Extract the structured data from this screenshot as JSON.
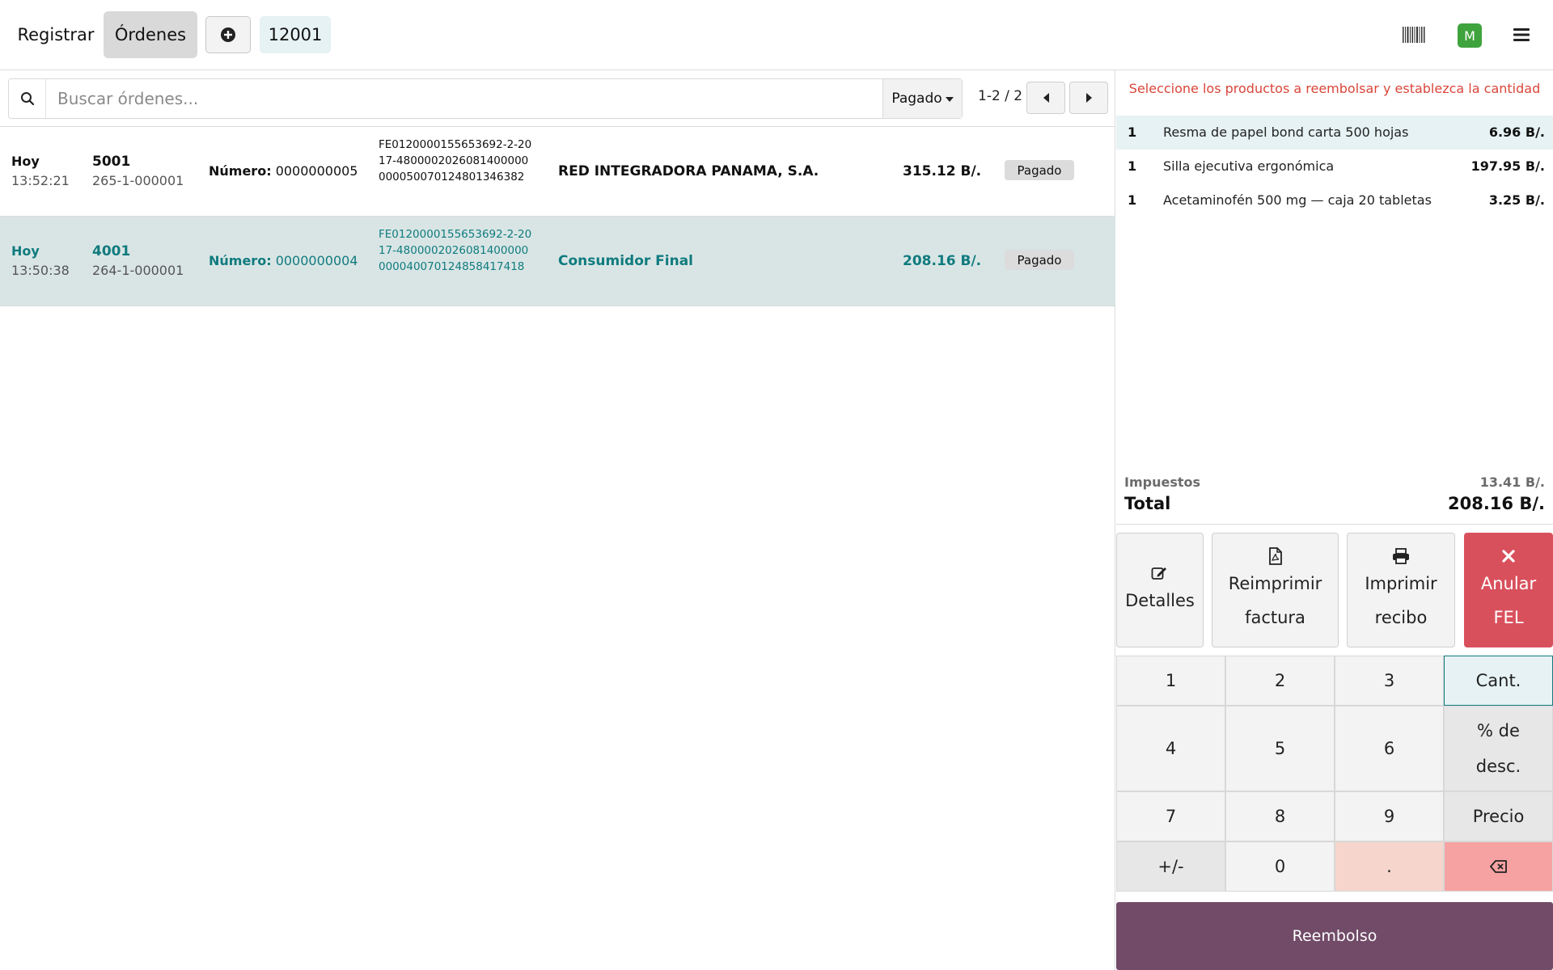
{
  "header": {
    "registrar_label": "Registrar",
    "ordenes_label": "Órdenes",
    "current_order": "12001",
    "avatar_initial": "M"
  },
  "search": {
    "placeholder": "Buscar órdenes...",
    "filter_label": "Pagado",
    "pager_text": "1-2 / 2"
  },
  "orders": [
    {
      "day": "Hoy",
      "time": "13:52:21",
      "number": "5001",
      "sequence": "265-1-000001",
      "numero_label": "Número:",
      "numero_value": "0000000005",
      "cufe": "FE0120000155653692-2-2017-4800002026081400000000050070124801346382",
      "client": "RED INTEGRADORA PANAMA, S.A.",
      "total": "315.12 B/.",
      "status": "Pagado"
    },
    {
      "day": "Hoy",
      "time": "13:50:38",
      "number": "4001",
      "sequence": "264-1-000001",
      "numero_label": "Número:",
      "numero_value": "0000000004",
      "cufe": "FE0120000155653692-2-2017-4800002026081400000000040070124858417418",
      "client": "Consumidor Final",
      "total": "208.16 B/.",
      "status": "Pagado"
    }
  ],
  "refund_panel": {
    "instruction": "Seleccione los productos a reembolsar y establezca la cantidad",
    "lines": [
      {
        "qty": "1",
        "name": "Resma de papel bond carta 500 hojas",
        "price": "6.96 B/."
      },
      {
        "qty": "1",
        "name": "Silla ejecutiva ergonómica",
        "price": "197.95 B/."
      },
      {
        "qty": "1",
        "name": "Acetaminofén 500 mg — caja 20 tabletas",
        "price": "3.25 B/."
      }
    ],
    "tax_label": "Impuestos",
    "tax_value": "13.41 B/.",
    "total_label": "Total",
    "total_value": "208.16 B/.",
    "actions": {
      "details": "Detalles",
      "reprint_line1": "Reimprimir",
      "reprint_line2": "factura",
      "print_line1": "Imprimir",
      "print_line2": "recibo",
      "cancel_line1": "Anular",
      "cancel_line2": "FEL"
    },
    "numpad": {
      "k1": "1",
      "k2": "2",
      "k3": "3",
      "qty": "Cant.",
      "k4": "4",
      "k5": "5",
      "k6": "6",
      "disc_line1": "% de",
      "disc_line2": "desc.",
      "k7": "7",
      "k8": "8",
      "k9": "9",
      "price": "Precio",
      "sign": "+/-",
      "k0": "0",
      "dot": "."
    },
    "refund_button": "Reembolso"
  },
  "colors": {
    "accent": "#107b7e",
    "refund_button": "#714b67",
    "cancel_button": "#d9505d",
    "instruction_text": "#d9463a",
    "avatar": "#3fa33d"
  }
}
